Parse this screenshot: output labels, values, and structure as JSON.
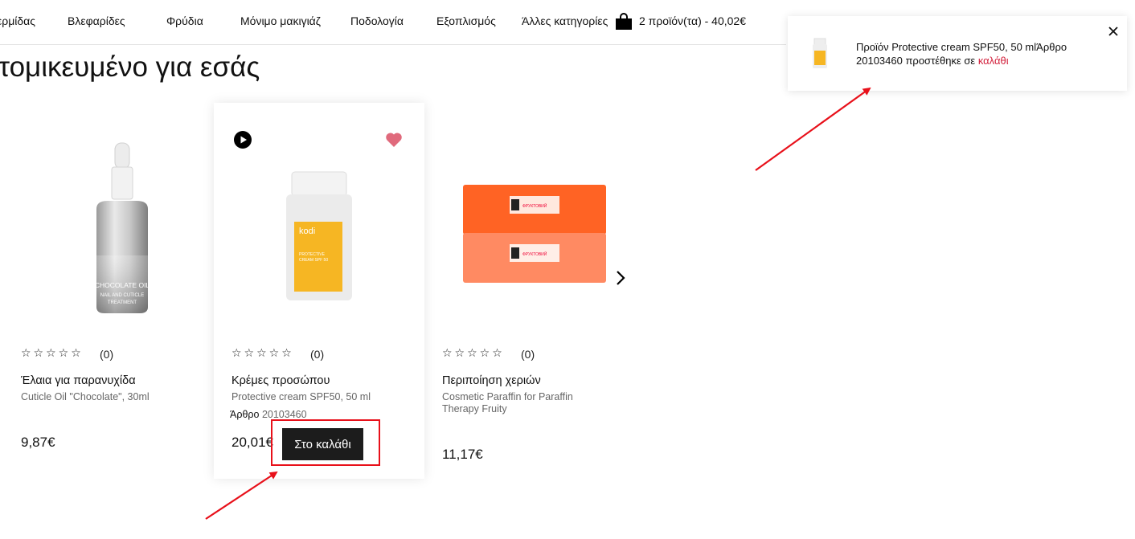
{
  "nav": {
    "items": [
      "ερμίδας",
      "Βλεφαρίδες",
      "Φρύδια",
      "Μόνιμο μακιγιάζ",
      "Ποδολογία",
      "Εξοπλισμός",
      "Άλλες κατηγορίες"
    ],
    "cart_summary": "2 προϊόν(τα) - 40,02€",
    "cart_icon": "shopping-bag-icon"
  },
  "section": {
    "title": "ατομικευμένο για εσάς"
  },
  "products": [
    {
      "category": "Έλαια για παρανυχίδα",
      "name": "Cuticle Oil \"Chocolate\", 30ml",
      "rating_count": "(0)",
      "stars": "☆☆☆☆☆",
      "price": "9,87€",
      "bottle_text_1": "CHOCOLATE OIL",
      "bottle_text_2": "NAIL AND CUTICLE",
      "bottle_text_3": "TREATMENT"
    },
    {
      "category": "Κρέμες προσώπου",
      "name": "Protective cream SPF50, 50 ml",
      "rating_count": "(0)",
      "stars": "☆☆☆☆☆",
      "article_label": "Άρθρο",
      "article_number": "20103460",
      "price": "20,01€",
      "add_to_cart": "Στο καλάθι",
      "brand": "kodi",
      "label_line_1": "PROTECTIVE",
      "label_line_2": "CREAM SPF 50"
    },
    {
      "category": "Περιποίηση χεριών",
      "name": "Cosmetic Paraffin for Paraffin Therapy Fruity",
      "rating_count": "(0)",
      "stars": "☆☆☆☆☆",
      "price": "11,17€",
      "pack_label_1": "ФРУКТОВИЙ",
      "pack_label_2": "ФРУКТОВИЙ"
    }
  ],
  "notification": {
    "text": "Προϊόν Protective cream SPF50, 50 mlΆρθρο 20103460 προστέθηκε σε",
    "link": "καλάθι"
  },
  "colors": {
    "accent": "#d21e3a",
    "button_bg": "#1c1c1c",
    "annotation": "#e8101a",
    "heart": "#e06a7c"
  }
}
